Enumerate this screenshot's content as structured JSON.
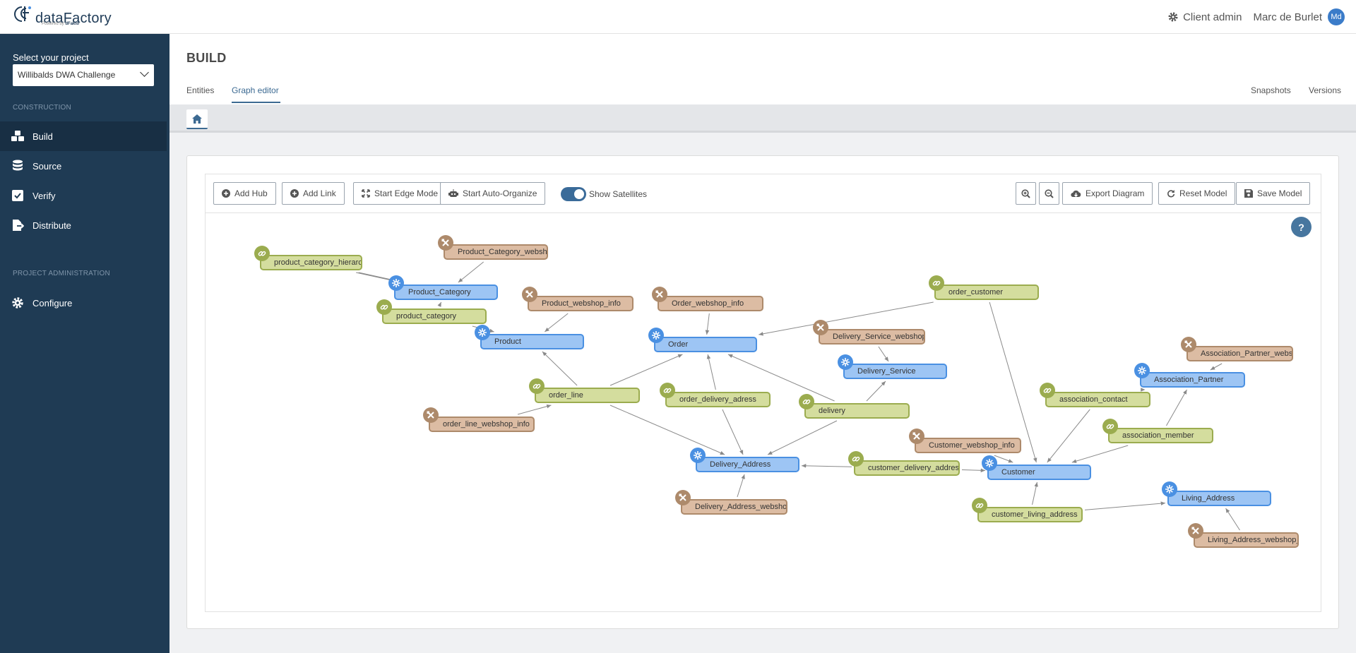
{
  "header": {
    "logo_text": "dataFactory",
    "logo_sub_prefix": "Powered by",
    "logo_sub_brand": "dFakto",
    "client_admin": "Client admin",
    "user_name": "Marc de Burlet",
    "user_initials": "Md"
  },
  "sidebar": {
    "project_label": "Select your project",
    "project_value": "Willibalds DWA Challenge",
    "section_construction": "CONSTRUCTION",
    "section_admin": "PROJECT ADMINISTRATION",
    "items": [
      {
        "label": "Build",
        "icon": "cubes-icon",
        "active": true
      },
      {
        "label": "Source",
        "icon": "database-icon",
        "active": false
      },
      {
        "label": "Verify",
        "icon": "check-square-icon",
        "active": false
      },
      {
        "label": "Distribute",
        "icon": "file-export-icon",
        "active": false
      },
      {
        "label": "Configure",
        "icon": "gear-icon",
        "active": false
      }
    ]
  },
  "page": {
    "title": "BUILD",
    "tabs": {
      "entities": "Entities",
      "graph_editor": "Graph editor"
    },
    "right_tabs": {
      "snapshots": "Snapshots",
      "versions": "Versions"
    }
  },
  "toolbar": {
    "add_hub": "Add Hub",
    "add_link": "Add Link",
    "start_edge_mode": "Start Edge Mode",
    "start_auto_organize": "Start Auto-Organize",
    "show_satellites": "Show Satellites",
    "show_satellites_on": true,
    "export_diagram": "Export Diagram",
    "reset_model": "Reset Model",
    "save_model": "Save Model",
    "help": "?"
  },
  "colors": {
    "sidebar_bg": "#1f3b54",
    "accent": "#3c6a92",
    "hub_fill": "#9dc5f4",
    "hub_border": "#4a90e2",
    "link_fill": "#d4dd9e",
    "link_border": "#9bac4f",
    "sat_fill": "#dcbca3",
    "sat_border": "#ad8a6b",
    "edge": "#8a8a8a"
  },
  "graph": {
    "nodes": [
      {
        "id": "pch",
        "label": "product_category_hierarch",
        "kind": "link"
      },
      {
        "id": "pcw",
        "label": "Product_Category_webshop",
        "kind": "sat"
      },
      {
        "id": "pc",
        "label": "Product_Category",
        "kind": "hub"
      },
      {
        "id": "pcat",
        "label": "product_category",
        "kind": "link"
      },
      {
        "id": "pwi",
        "label": "Product_webshop_info",
        "kind": "sat"
      },
      {
        "id": "prod",
        "label": "Product",
        "kind": "hub"
      },
      {
        "id": "owi",
        "label": "Order_webshop_info",
        "kind": "sat"
      },
      {
        "id": "ord",
        "label": "Order",
        "kind": "hub"
      },
      {
        "id": "ocust",
        "label": "order_customer",
        "kind": "link"
      },
      {
        "id": "dsw",
        "label": "Delivery_Service_webshop",
        "kind": "sat"
      },
      {
        "id": "ds",
        "label": "Delivery_Service",
        "kind": "hub"
      },
      {
        "id": "apw",
        "label": "Association_Partner_websh",
        "kind": "sat"
      },
      {
        "id": "ap",
        "label": "Association_Partner",
        "kind": "hub"
      },
      {
        "id": "ol",
        "label": "order_line",
        "kind": "link"
      },
      {
        "id": "oda",
        "label": "order_delivery_adress",
        "kind": "link"
      },
      {
        "id": "del",
        "label": "delivery",
        "kind": "link"
      },
      {
        "id": "ac",
        "label": "association_contact",
        "kind": "link"
      },
      {
        "id": "olw",
        "label": "order_line_webshop_info",
        "kind": "sat"
      },
      {
        "id": "am",
        "label": "association_member",
        "kind": "link"
      },
      {
        "id": "cwi",
        "label": "Customer_webshop_info",
        "kind": "sat"
      },
      {
        "id": "da",
        "label": "Delivery_Address",
        "kind": "hub"
      },
      {
        "id": "cda",
        "label": "customer_delivery_address",
        "kind": "link"
      },
      {
        "id": "cust",
        "label": "Customer",
        "kind": "hub"
      },
      {
        "id": "la",
        "label": "Living_Address",
        "kind": "hub"
      },
      {
        "id": "daw",
        "label": "Delivery_Address_webshop",
        "kind": "sat"
      },
      {
        "id": "cla",
        "label": "customer_living_address",
        "kind": "link"
      },
      {
        "id": "law",
        "label": "Living_Address_webshop_i",
        "kind": "sat"
      }
    ],
    "edges": [
      [
        "pch",
        "pc"
      ],
      [
        "pch",
        "pc"
      ],
      [
        "pcw",
        "pc"
      ],
      [
        "pcat",
        "pc"
      ],
      [
        "pcat",
        "prod"
      ],
      [
        "pwi",
        "prod"
      ],
      [
        "ol",
        "prod"
      ],
      [
        "ol",
        "ord"
      ],
      [
        "ol",
        "da"
      ],
      [
        "olw",
        "ol"
      ],
      [
        "owi",
        "ord"
      ],
      [
        "ocust",
        "ord"
      ],
      [
        "ocust",
        "cust"
      ],
      [
        "oda",
        "ord"
      ],
      [
        "oda",
        "da"
      ],
      [
        "del",
        "ord"
      ],
      [
        "del",
        "ds"
      ],
      [
        "del",
        "da"
      ],
      [
        "dsw",
        "ds"
      ],
      [
        "cda",
        "da"
      ],
      [
        "cda",
        "cust"
      ],
      [
        "daw",
        "da"
      ],
      [
        "cwi",
        "cust"
      ],
      [
        "ac",
        "ap"
      ],
      [
        "ac",
        "cust"
      ],
      [
        "am",
        "ap"
      ],
      [
        "am",
        "cust"
      ],
      [
        "apw",
        "ap"
      ],
      [
        "cla",
        "cust"
      ],
      [
        "cla",
        "la"
      ],
      [
        "law",
        "la"
      ]
    ]
  }
}
